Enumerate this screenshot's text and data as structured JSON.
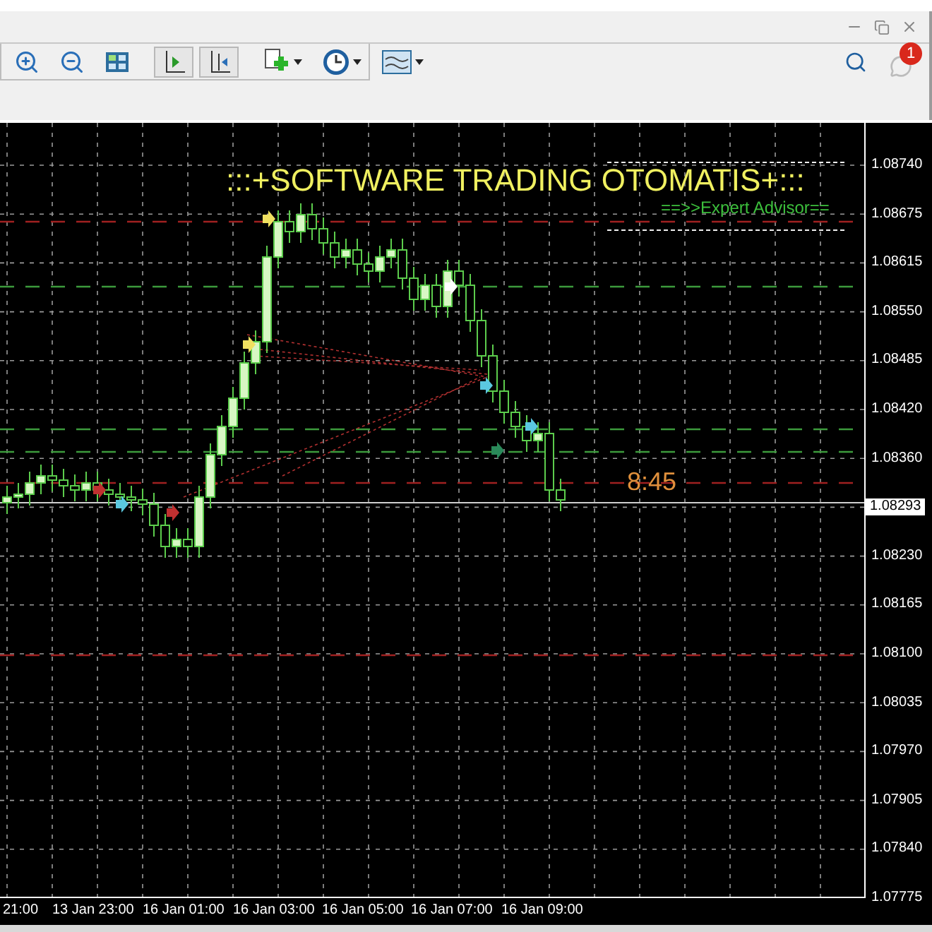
{
  "toolbar": {
    "buttons": [
      {
        "kind": "zoom_in",
        "pressed": false
      },
      {
        "kind": "zoom_out",
        "pressed": false
      },
      {
        "kind": "tile",
        "pressed": false
      },
      {
        "kind": "chart_shift",
        "pressed": true
      },
      {
        "kind": "auto_scroll",
        "pressed": true
      },
      {
        "kind": "new_chart",
        "pressed": false
      },
      {
        "kind": "periods",
        "pressed": false
      },
      {
        "kind": "templates",
        "pressed": false
      }
    ]
  },
  "notifications": {
    "count": "1"
  },
  "chart": {
    "title": ":::+SOFTWARE TRADING OTOMATIS+:::",
    "subtitle": "==>>Expert Advisor==",
    "timer": "8:45",
    "price_ticks": [
      "1.08740",
      "1.08675",
      "1.08615",
      "1.08550",
      "1.08485",
      "1.08420",
      "1.08360",
      "1.08230",
      "1.08165",
      "1.08100",
      "1.08035",
      "1.07970",
      "1.07905",
      "1.07840",
      "1.07775"
    ],
    "current_price": "1.08293",
    "time_labels": [
      "21:00",
      "13 Jan 23:00",
      "16 Jan 01:00",
      "16 Jan 03:00",
      "16 Jan 05:00",
      "16 Jan 07:00",
      "16 Jan 09:00"
    ]
  }
}
